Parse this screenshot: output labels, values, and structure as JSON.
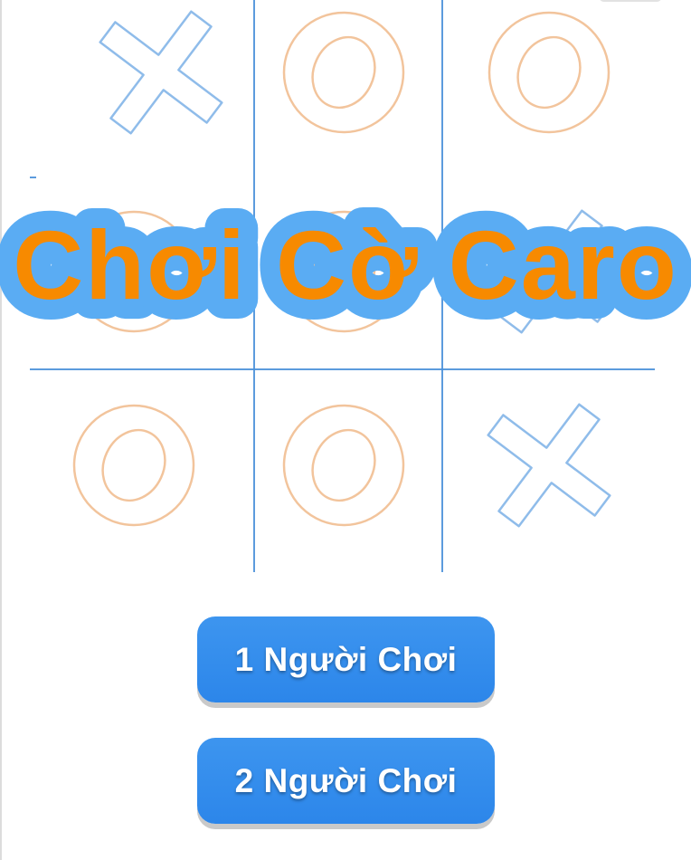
{
  "title": "Chơi Cờ Caro",
  "board": {
    "cells": [
      "X",
      "O",
      "O",
      "O",
      "O",
      "X",
      "O",
      "O",
      "X"
    ]
  },
  "menu": {
    "one_player_label": "1 Người Chơi",
    "two_player_label": "2 Người Chơi"
  },
  "colors": {
    "grid_line": "#4a90d9",
    "x_mark": "#8fbcea",
    "o_mark": "#f2c49c",
    "title_fill": "#f78a00",
    "title_outline": "#5aacf3",
    "button": "#3a92ee",
    "button_text": "#ffffff"
  }
}
